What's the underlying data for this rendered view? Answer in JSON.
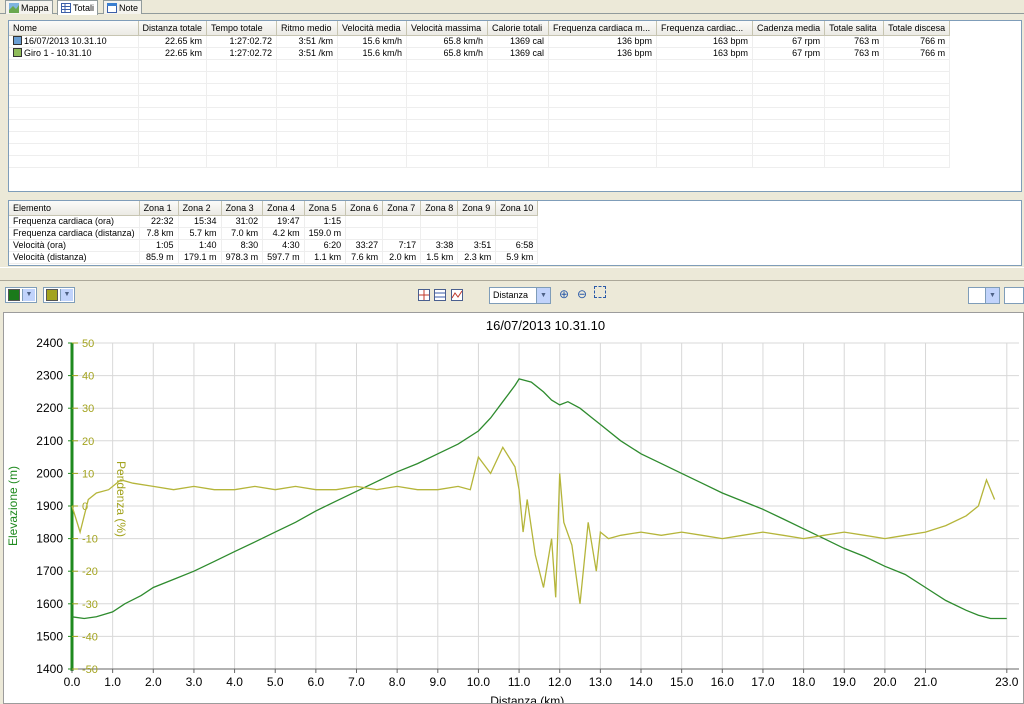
{
  "tabs": [
    {
      "label": "Mappa",
      "icon": "map-icon"
    },
    {
      "label": "Totali",
      "icon": "table-icon"
    },
    {
      "label": "Note",
      "icon": "notes-icon"
    }
  ],
  "totals": {
    "columns": [
      "Nome",
      "Distanza totale",
      "Tempo totale",
      "Ritmo medio",
      "Velocità media",
      "Velocità massima",
      "Calorie totali",
      "Frequenza cardiaca m...",
      "Frequenza cardiac...",
      "Cadenza media",
      "Totale salita",
      "Totale discesa"
    ],
    "rows": [
      {
        "icon": "activity-icon",
        "cells": [
          "16/07/2013 10.31.10",
          "22.65 km",
          "1:27:02.72",
          "3:51 /km",
          "15.6 km/h",
          "65.8 km/h",
          "1369 cal",
          "136 bpm",
          "163 bpm",
          "67 rpm",
          "763 m",
          "766 m"
        ]
      },
      {
        "icon": "lap-icon",
        "cells": [
          "Giro 1 - 10.31.10",
          "22.65 km",
          "1:27:02.72",
          "3:51 /km",
          "15.6 km/h",
          "65.8 km/h",
          "1369 cal",
          "136 bpm",
          "163 bpm",
          "67 rpm",
          "763 m",
          "766 m"
        ]
      }
    ]
  },
  "zones": {
    "columns": [
      "Elemento",
      "Zona 1",
      "Zona 2",
      "Zona 3",
      "Zona 4",
      "Zona 5",
      "Zona 6",
      "Zona 7",
      "Zona 8",
      "Zona 9",
      "Zona 10"
    ],
    "rows": [
      [
        "Frequenza cardiaca (ora)",
        "22:32",
        "15:34",
        "31:02",
        "19:47",
        "1:15",
        "",
        "",
        "",
        "",
        ""
      ],
      [
        "Frequenza cardiaca (distanza)",
        "7.8 km",
        "5.7 km",
        "7.0 km",
        "4.2 km",
        "159.0 m",
        "",
        "",
        "",
        "",
        ""
      ],
      [
        "Velocità (ora)",
        "1:05",
        "1:40",
        "8:30",
        "4:30",
        "6:20",
        "33:27",
        "7:17",
        "3:38",
        "3:51",
        "6:58"
      ],
      [
        "Velocità (distanza)",
        "85.9 m",
        "179.1 m",
        "978.3 m",
        "597.7 m",
        "1.1 km",
        "7.6 km",
        "2.0 km",
        "1.5 km",
        "2.3 km",
        "5.9 km"
      ]
    ]
  },
  "toolbar": {
    "series1_color": "#1a7a1a",
    "series2_color": "#a3a31e",
    "axis_select_value": "Distanza",
    "icons": [
      "crosshair-icon",
      "fit-rows-icon",
      "chart-type-icon",
      "zoom-in-icon",
      "zoom-out-icon",
      "fit-icon"
    ]
  },
  "chart_data": {
    "type": "line",
    "title": "16/07/2013 10.31.10",
    "xlabel": "Distanza (km)",
    "ylabel": "Elevazione (m)",
    "y2label": "Pendenza (%)",
    "xlim": [
      0,
      23.0
    ],
    "ylim": [
      1400,
      2400
    ],
    "y2lim": [
      -50,
      50
    ],
    "x_ticks": [
      0.0,
      1.0,
      2.0,
      3.0,
      4.0,
      5.0,
      6.0,
      7.0,
      8.0,
      9.0,
      10.0,
      11.0,
      12.0,
      13.0,
      14.0,
      15.0,
      16.0,
      17.0,
      18.0,
      19.0,
      20.0,
      21.0,
      23.0
    ],
    "x_tick_labels": [
      "0.0",
      "1.0",
      "2.0",
      "3.0",
      "4.0",
      "5.0",
      "6.0",
      "7.0",
      "8.0",
      "9.0",
      "10.0",
      "11.0",
      "12.0",
      "13.0",
      "14.0",
      "15.0",
      "16.0",
      "17.0",
      "18.0",
      "19.0",
      "20.0",
      "21.0",
      "23.0"
    ],
    "y_ticks": [
      1400,
      1500,
      1600,
      1700,
      1800,
      1900,
      2000,
      2100,
      2200,
      2300,
      2400
    ],
    "y2_ticks": [
      -50,
      -40,
      -30,
      -20,
      -10,
      0,
      10,
      20,
      30,
      40,
      50
    ],
    "grid": true,
    "series": [
      {
        "name": "Elevazione",
        "axis": "left",
        "color": "#2e8b2e",
        "x": [
          0.0,
          0.3,
          0.6,
          1.0,
          1.3,
          1.7,
          2.0,
          2.5,
          3.0,
          3.5,
          4.0,
          4.5,
          5.0,
          5.5,
          6.0,
          6.5,
          7.0,
          7.5,
          8.0,
          8.5,
          9.0,
          9.5,
          10.0,
          10.3,
          10.6,
          10.9,
          11.0,
          11.3,
          11.6,
          11.8,
          12.0,
          12.2,
          12.5,
          12.8,
          13.0,
          13.5,
          14.0,
          14.5,
          15.0,
          15.5,
          16.0,
          16.5,
          17.0,
          17.5,
          18.0,
          18.5,
          19.0,
          19.5,
          20.0,
          20.5,
          21.0,
          21.5,
          22.0,
          22.3,
          22.6,
          23.0
        ],
        "values": [
          1560,
          1555,
          1560,
          1575,
          1600,
          1625,
          1650,
          1675,
          1700,
          1730,
          1760,
          1790,
          1820,
          1850,
          1885,
          1915,
          1945,
          1975,
          2005,
          2030,
          2060,
          2090,
          2130,
          2170,
          2220,
          2270,
          2290,
          2280,
          2250,
          2225,
          2210,
          2220,
          2200,
          2170,
          2150,
          2100,
          2060,
          2030,
          2000,
          1970,
          1940,
          1915,
          1890,
          1860,
          1830,
          1800,
          1770,
          1745,
          1715,
          1690,
          1650,
          1610,
          1580,
          1565,
          1555,
          1555
        ]
      },
      {
        "name": "Pendenza",
        "axis": "right",
        "color": "#b5b53a",
        "x": [
          0.0,
          0.2,
          0.4,
          0.6,
          0.9,
          1.2,
          1.5,
          2.0,
          2.5,
          3.0,
          3.5,
          4.0,
          4.5,
          5.0,
          5.5,
          6.0,
          6.5,
          7.0,
          7.5,
          8.0,
          8.5,
          9.0,
          9.5,
          9.8,
          10.0,
          10.3,
          10.6,
          10.9,
          11.0,
          11.1,
          11.2,
          11.4,
          11.6,
          11.8,
          11.9,
          12.0,
          12.1,
          12.3,
          12.5,
          12.7,
          12.9,
          13.0,
          13.2,
          13.5,
          14.0,
          14.5,
          15.0,
          15.5,
          16.0,
          16.5,
          17.0,
          17.5,
          18.0,
          18.5,
          19.0,
          19.5,
          20.0,
          20.5,
          21.0,
          21.5,
          22.0,
          22.3,
          22.5,
          22.7
        ],
        "values": [
          0,
          -8,
          2,
          4,
          5,
          8,
          7,
          6,
          5,
          6,
          5,
          5,
          6,
          5,
          6,
          5,
          5,
          6,
          5,
          6,
          5,
          5,
          6,
          5,
          15,
          10,
          18,
          12,
          5,
          -8,
          2,
          -15,
          -25,
          -10,
          -28,
          10,
          -5,
          -12,
          -30,
          -5,
          -20,
          -8,
          -10,
          -9,
          -8,
          -9,
          -8,
          -9,
          -10,
          -9,
          -8,
          -9,
          -10,
          -9,
          -8,
          -9,
          -10,
          -9,
          -8,
          -6,
          -3,
          0,
          8,
          2
        ]
      }
    ]
  }
}
